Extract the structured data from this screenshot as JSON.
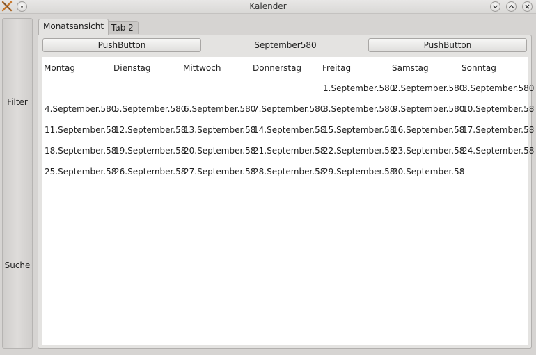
{
  "window": {
    "title": "Kalender"
  },
  "dock": {
    "items": [
      {
        "label": "Filter"
      },
      {
        "label": "Suche"
      }
    ]
  },
  "tabs": [
    {
      "label": "Monatsansicht",
      "active": true
    },
    {
      "label": "Tab 2",
      "active": false
    }
  ],
  "nav": {
    "prev_label": "PushButton",
    "month_label": "September580",
    "next_label": "PushButton"
  },
  "calendar": {
    "weekdays": [
      "Montag",
      "Dienstag",
      "Mittwoch",
      "Donnerstag",
      "Freitag",
      "Samstag",
      "Sonntag"
    ],
    "weeks": [
      [
        "",
        "",
        "",
        "",
        "1.September.580",
        "2.September.580",
        "3.September.580"
      ],
      [
        "4.September.580",
        "5.September.580",
        "6.September.580",
        "7.September.580",
        "8.September.580",
        "9.September.580",
        "10.September.58"
      ],
      [
        "11.September.58",
        "12.September.58",
        "13.September.58",
        "14.September.58",
        "15.September.58",
        "16.September.58",
        "17.September.58"
      ],
      [
        "18.September.58",
        "19.September.58",
        "20.September.58",
        "21.September.58",
        "22.September.58",
        "23.September.58",
        "24.September.58"
      ],
      [
        "25.September.58",
        "26.September.58",
        "27.September.58",
        "28.September.58",
        "29.September.58",
        "30.September.58",
        ""
      ]
    ]
  }
}
